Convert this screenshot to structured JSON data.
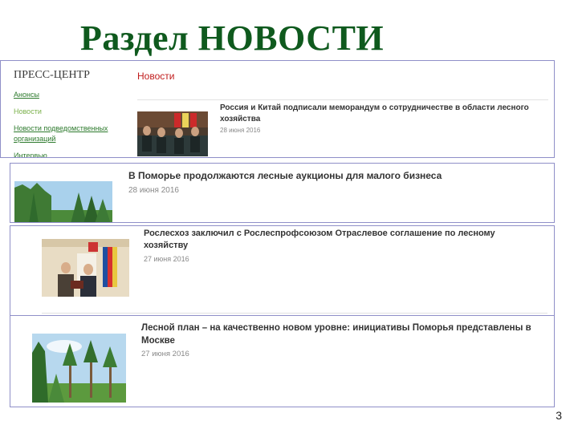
{
  "slide": {
    "title": "Раздел  НОВОСТИ",
    "page_number": "3"
  },
  "sidebar": {
    "title": "ПРЕСС-ЦЕНТР",
    "items": [
      {
        "label": "Анонсы"
      },
      {
        "label": "Новости"
      },
      {
        "label": "Новости подведомственных организаций"
      },
      {
        "label": "Интервью"
      }
    ]
  },
  "news_section": {
    "heading": "Новости"
  },
  "news": [
    {
      "title": "Россия и Китай подписали меморандум о сотрудничестве в области лесного хозяйства",
      "date": "28 июня 2016"
    },
    {
      "title": "В Поморье продолжаются лесные аукционы для малого бизнеса",
      "date": "28 июня 2016"
    },
    {
      "title": "Рослесхоз заключил с Рослеспрофсоюзом Отраслевое соглашение по лесному хозяйству",
      "date": "27 июня 2016"
    },
    {
      "title": "Лесной план – на качественно новом уровне: инициативы Поморья представлены в Москве",
      "date": "27 июня 2016"
    }
  ],
  "colors": {
    "title_green": "#0f5a1e",
    "link_green": "#2d7a2d",
    "active_green": "#7ab04a",
    "section_red": "#c01b1b",
    "panel_border": "#8f8fc8"
  }
}
